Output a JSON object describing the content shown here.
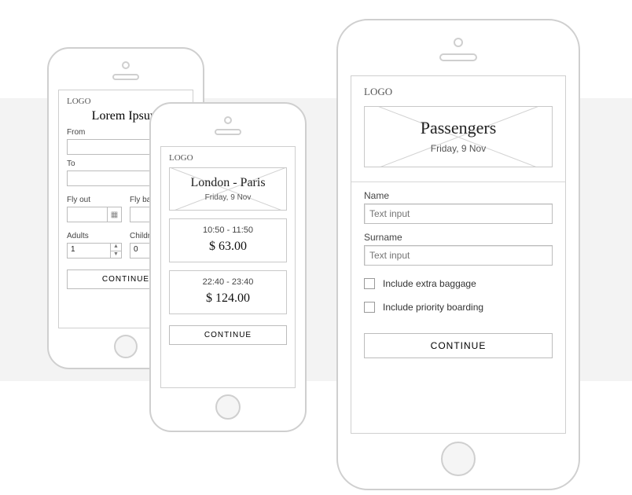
{
  "screen1": {
    "logo": "LOGO",
    "title": "Lorem Ipsum",
    "from_label": "From",
    "to_label": "To",
    "flyout_label": "Fly out",
    "flyback_label": "Fly back",
    "adults_label": "Adults",
    "children_label": "Children",
    "adults_value": "1",
    "children_value": "0",
    "continue": "CONTINUE"
  },
  "screen2": {
    "logo": "LOGO",
    "route": "London - Paris",
    "date": "Friday, 9 Nov",
    "flights": [
      {
        "time": "10:50 - 11:50",
        "price": "$ 63.00"
      },
      {
        "time": "22:40 - 23:40",
        "price": "$ 124.00"
      }
    ],
    "continue": "CONTINUE"
  },
  "screen3": {
    "logo": "LOGO",
    "title": "Passengers",
    "date": "Friday, 9 Nov",
    "name_label": "Name",
    "surname_label": "Surname",
    "input_placeholder": "Text input",
    "baggage_label": "Include extra baggage",
    "priority_label": "Include priority boarding",
    "continue": "CONTINUE"
  }
}
